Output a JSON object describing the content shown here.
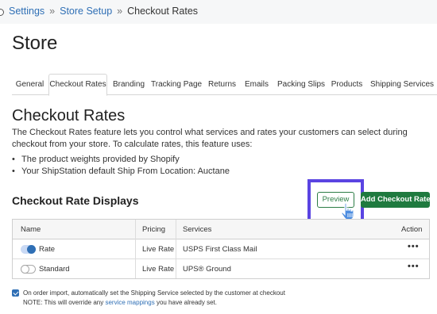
{
  "breadcrumb": {
    "items": [
      "Settings",
      "Store Setup"
    ],
    "separator": "»",
    "current": "Checkout Rates"
  },
  "page_title": "Store",
  "tabs": [
    {
      "label": "General",
      "active": false
    },
    {
      "label": "Checkout Rates",
      "active": true
    },
    {
      "label": "Branding",
      "active": false
    },
    {
      "label": "Tracking Page",
      "active": false
    },
    {
      "label": "Returns",
      "active": false
    },
    {
      "label": "Emails",
      "active": false
    },
    {
      "label": "Packing Slips",
      "active": false
    },
    {
      "label": "Products",
      "active": false
    },
    {
      "label": "Shipping Services",
      "active": false
    }
  ],
  "section": {
    "title": "Checkout Rates",
    "description": "The Checkout Rates feature lets you control what services and rates your customers can select during checkout from your store. To calculate rates, this feature uses:",
    "bullets": [
      "The product weights provided by Shopify",
      "Your ShipStation default Ship From Location: Auctane"
    ]
  },
  "displays": {
    "title": "Checkout Rate Displays",
    "preview_label": "Preview",
    "add_label": "Add Checkout Rate"
  },
  "table": {
    "headers": {
      "name": "Name",
      "pricing": "Pricing",
      "services": "Services",
      "action": "Action"
    },
    "rows": [
      {
        "name": "Rate",
        "pricing": "Live Rate",
        "services": "USPS First Class Mail",
        "enabled": true,
        "action": "•••"
      },
      {
        "name": "Standard",
        "pricing": "Live Rate",
        "services": "UPS® Ground",
        "enabled": false,
        "action": "•••"
      }
    ]
  },
  "option": {
    "checked": true,
    "label": "On order import, automatically set the Shipping Service selected by the customer at checkout",
    "note_prefix": "NOTE: This will override any",
    "note_link": "service mappings",
    "note_suffix": "you have already set."
  },
  "colors": {
    "link": "#2f6fb5",
    "primary_green": "#1f7a3f",
    "highlight": "#5a44e2"
  }
}
